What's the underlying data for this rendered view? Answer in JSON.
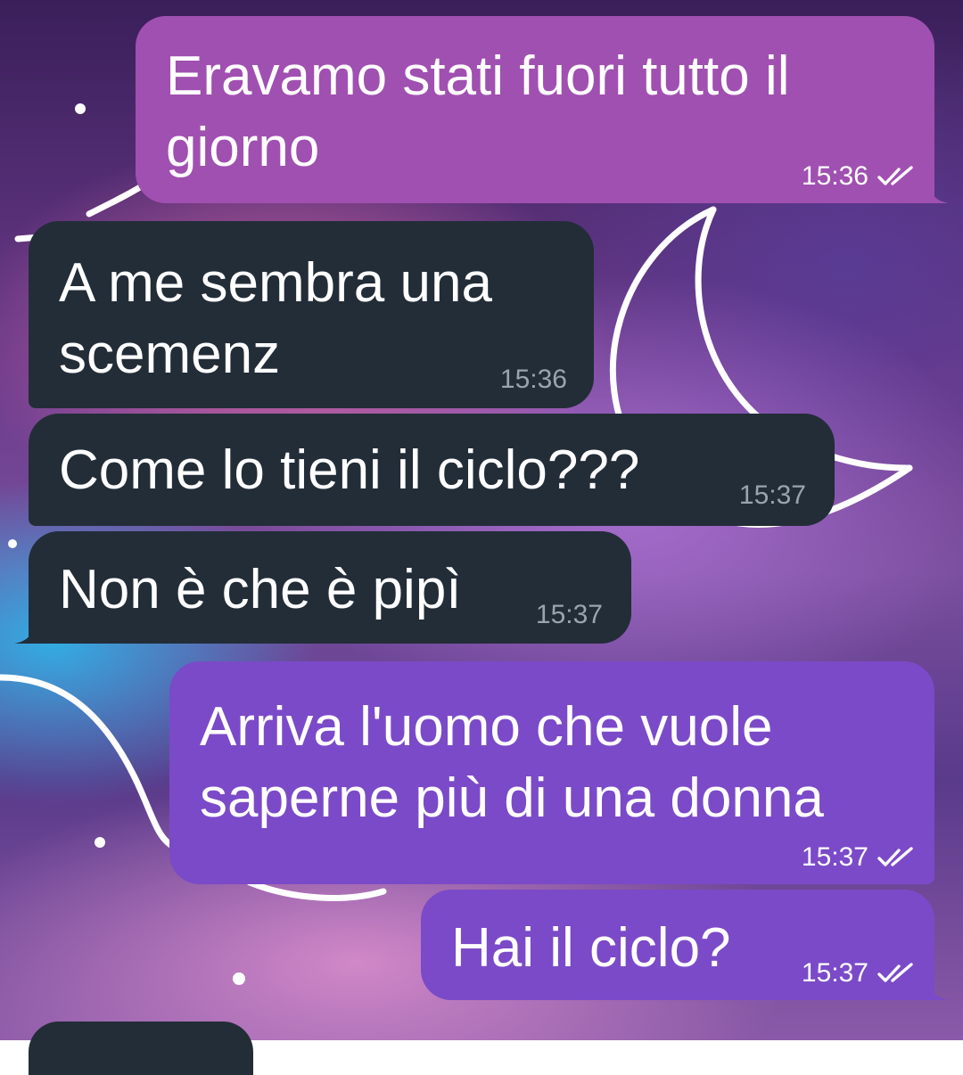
{
  "colors": {
    "outgoing_a": "#a050b0",
    "outgoing_b": "#7b4ac8",
    "incoming": "#232d38",
    "meta_incoming": "#9aa4ae"
  },
  "messages": [
    {
      "id": "m1",
      "direction": "outgoing",
      "text": "Eravamo stati fuori tutto il\ngiorno",
      "time": "15:36",
      "status_icon": "double-check-icon"
    },
    {
      "id": "m2",
      "direction": "incoming",
      "text": "A me sembra una\nscemenz",
      "time": "15:36"
    },
    {
      "id": "m3",
      "direction": "incoming",
      "text": "Come lo tieni il ciclo???",
      "time": "15:37"
    },
    {
      "id": "m4",
      "direction": "incoming",
      "text": "Non è che è pipì",
      "time": "15:37"
    },
    {
      "id": "m5",
      "direction": "outgoing",
      "text": "Arriva l'uomo che vuole\nsaperne più di una donna",
      "time": "15:37",
      "status_icon": "double-check-icon"
    },
    {
      "id": "m6",
      "direction": "outgoing",
      "text": "Hai il ciclo?",
      "time": "15:37",
      "status_icon": "double-check-icon"
    }
  ]
}
